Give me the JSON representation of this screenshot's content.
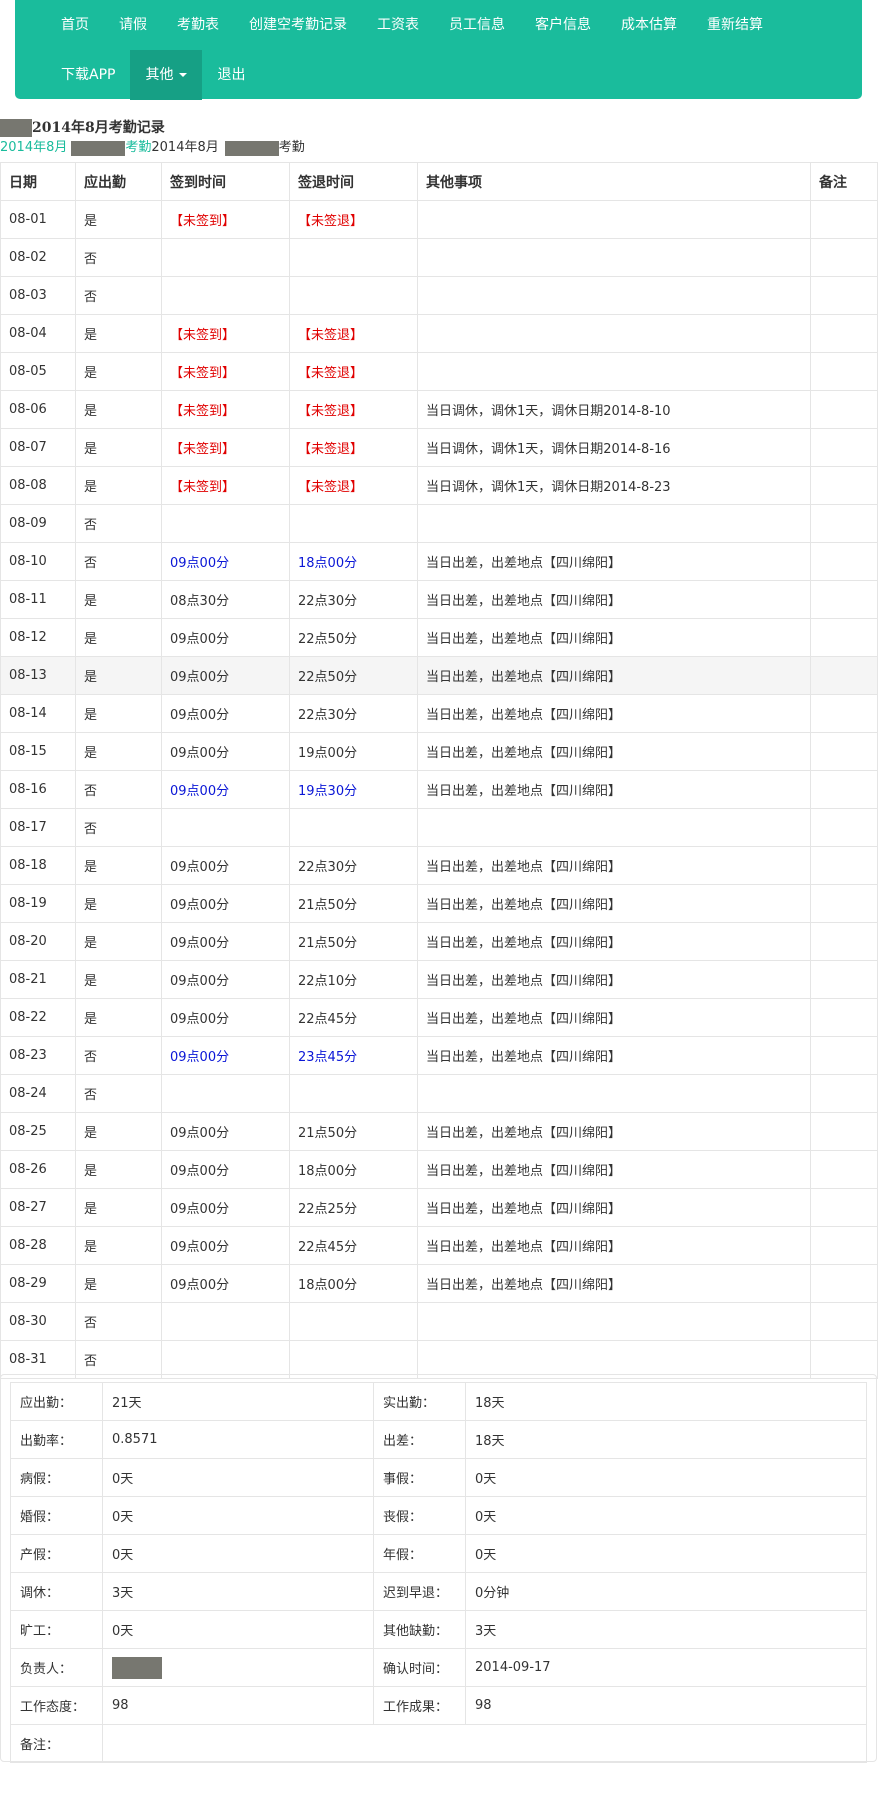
{
  "nav": {
    "row1": [
      "首页",
      "请假",
      "考勤表",
      "创建空考勤记录",
      "工资表",
      "员工信息",
      "客户信息",
      "成本估算",
      "重新结算"
    ],
    "download": "下载APP",
    "other": "其他",
    "logout": "退出"
  },
  "header": {
    "title": "2014年8月考勤记录",
    "sub_a": "2014年8月",
    "sub_b": "考勤",
    "sub_c": "2014年8月",
    "sub_d": "考勤"
  },
  "table": {
    "columns": [
      "日期",
      "应出勤",
      "签到时间",
      "签退时间",
      "其他事项",
      "备注"
    ],
    "rows": [
      {
        "date": "08-01",
        "req": "是",
        "in": "【未签到】",
        "out": "【未签退】",
        "note": "",
        "remark": "",
        "style": "red"
      },
      {
        "date": "08-02",
        "req": "否",
        "in": "",
        "out": "",
        "note": "",
        "remark": "",
        "style": ""
      },
      {
        "date": "08-03",
        "req": "否",
        "in": "",
        "out": "",
        "note": "",
        "remark": "",
        "style": ""
      },
      {
        "date": "08-04",
        "req": "是",
        "in": "【未签到】",
        "out": "【未签退】",
        "note": "",
        "remark": "",
        "style": "red"
      },
      {
        "date": "08-05",
        "req": "是",
        "in": "【未签到】",
        "out": "【未签退】",
        "note": "",
        "remark": "",
        "style": "red"
      },
      {
        "date": "08-06",
        "req": "是",
        "in": "【未签到】",
        "out": "【未签退】",
        "note": "当日调休，调休1天，调休日期2014-8-10",
        "remark": "",
        "style": "red"
      },
      {
        "date": "08-07",
        "req": "是",
        "in": "【未签到】",
        "out": "【未签退】",
        "note": "当日调休，调休1天，调休日期2014-8-16",
        "remark": "",
        "style": "red"
      },
      {
        "date": "08-08",
        "req": "是",
        "in": "【未签到】",
        "out": "【未签退】",
        "note": "当日调休，调休1天，调休日期2014-8-23",
        "remark": "",
        "style": "red"
      },
      {
        "date": "08-09",
        "req": "否",
        "in": "",
        "out": "",
        "note": "",
        "remark": "",
        "style": ""
      },
      {
        "date": "08-10",
        "req": "否",
        "in": "09点00分",
        "out": "18点00分",
        "note": "当日出差，出差地点【四川绵阳】",
        "remark": "",
        "style": "blue"
      },
      {
        "date": "08-11",
        "req": "是",
        "in": "08点30分",
        "out": "22点30分",
        "note": "当日出差，出差地点【四川绵阳】",
        "remark": "",
        "style": ""
      },
      {
        "date": "08-12",
        "req": "是",
        "in": "09点00分",
        "out": "22点50分",
        "note": "当日出差，出差地点【四川绵阳】",
        "remark": "",
        "style": ""
      },
      {
        "date": "08-13",
        "req": "是",
        "in": "09点00分",
        "out": "22点50分",
        "note": "当日出差，出差地点【四川绵阳】",
        "remark": "",
        "style": "",
        "highlight": true
      },
      {
        "date": "08-14",
        "req": "是",
        "in": "09点00分",
        "out": "22点30分",
        "note": "当日出差，出差地点【四川绵阳】",
        "remark": "",
        "style": ""
      },
      {
        "date": "08-15",
        "req": "是",
        "in": "09点00分",
        "out": "19点00分",
        "note": "当日出差，出差地点【四川绵阳】",
        "remark": "",
        "style": ""
      },
      {
        "date": "08-16",
        "req": "否",
        "in": "09点00分",
        "out": "19点30分",
        "note": "当日出差，出差地点【四川绵阳】",
        "remark": "",
        "style": "blue"
      },
      {
        "date": "08-17",
        "req": "否",
        "in": "",
        "out": "",
        "note": "",
        "remark": "",
        "style": ""
      },
      {
        "date": "08-18",
        "req": "是",
        "in": "09点00分",
        "out": "22点30分",
        "note": "当日出差，出差地点【四川绵阳】",
        "remark": "",
        "style": ""
      },
      {
        "date": "08-19",
        "req": "是",
        "in": "09点00分",
        "out": "21点50分",
        "note": "当日出差，出差地点【四川绵阳】",
        "remark": "",
        "style": ""
      },
      {
        "date": "08-20",
        "req": "是",
        "in": "09点00分",
        "out": "21点50分",
        "note": "当日出差，出差地点【四川绵阳】",
        "remark": "",
        "style": ""
      },
      {
        "date": "08-21",
        "req": "是",
        "in": "09点00分",
        "out": "22点10分",
        "note": "当日出差，出差地点【四川绵阳】",
        "remark": "",
        "style": ""
      },
      {
        "date": "08-22",
        "req": "是",
        "in": "09点00分",
        "out": "22点45分",
        "note": "当日出差，出差地点【四川绵阳】",
        "remark": "",
        "style": ""
      },
      {
        "date": "08-23",
        "req": "否",
        "in": "09点00分",
        "out": "23点45分",
        "note": "当日出差，出差地点【四川绵阳】",
        "remark": "",
        "style": "blue"
      },
      {
        "date": "08-24",
        "req": "否",
        "in": "",
        "out": "",
        "note": "",
        "remark": "",
        "style": ""
      },
      {
        "date": "08-25",
        "req": "是",
        "in": "09点00分",
        "out": "21点50分",
        "note": "当日出差，出差地点【四川绵阳】",
        "remark": "",
        "style": ""
      },
      {
        "date": "08-26",
        "req": "是",
        "in": "09点00分",
        "out": "18点00分",
        "note": "当日出差，出差地点【四川绵阳】",
        "remark": "",
        "style": ""
      },
      {
        "date": "08-27",
        "req": "是",
        "in": "09点00分",
        "out": "22点25分",
        "note": "当日出差，出差地点【四川绵阳】",
        "remark": "",
        "style": ""
      },
      {
        "date": "08-28",
        "req": "是",
        "in": "09点00分",
        "out": "22点45分",
        "note": "当日出差，出差地点【四川绵阳】",
        "remark": "",
        "style": ""
      },
      {
        "date": "08-29",
        "req": "是",
        "in": "09点00分",
        "out": "18点00分",
        "note": "当日出差，出差地点【四川绵阳】",
        "remark": "",
        "style": ""
      },
      {
        "date": "08-30",
        "req": "否",
        "in": "",
        "out": "",
        "note": "",
        "remark": "",
        "style": ""
      },
      {
        "date": "08-31",
        "req": "否",
        "in": "",
        "out": "",
        "note": "",
        "remark": "",
        "style": ""
      }
    ]
  },
  "summary": {
    "rows": [
      [
        {
          "l": "应出勤：",
          "v": "21天"
        },
        {
          "l": "实出勤：",
          "v": "18天"
        }
      ],
      [
        {
          "l": "出勤率：",
          "v": "0.8571"
        },
        {
          "l": "出差：",
          "v": "18天"
        }
      ],
      [
        {
          "l": "病假：",
          "v": "0天"
        },
        {
          "l": "事假：",
          "v": "0天"
        }
      ],
      [
        {
          "l": "婚假：",
          "v": "0天"
        },
        {
          "l": "丧假：",
          "v": "0天"
        }
      ],
      [
        {
          "l": "产假：",
          "v": "0天"
        },
        {
          "l": "年假：",
          "v": "0天"
        }
      ],
      [
        {
          "l": "调休：",
          "v": "3天"
        },
        {
          "l": "迟到早退：",
          "v": "0分钟"
        }
      ],
      [
        {
          "l": "旷工：",
          "v": "0天"
        },
        {
          "l": "其他缺勤：",
          "v": "3天"
        }
      ],
      [
        {
          "l": "负责人：",
          "v": "",
          "redacted": true
        },
        {
          "l": "确认时间：",
          "v": "2014-09-17"
        }
      ],
      [
        {
          "l": "工作态度：",
          "v": "98"
        },
        {
          "l": "工作成果：",
          "v": "98"
        }
      ]
    ],
    "remark_label": "备注：",
    "remark_value": ""
  },
  "colors": {
    "accent": "#1abc9c",
    "accent_dark": "#16a085",
    "warn": "#e00000",
    "link": "#0a16d6"
  }
}
